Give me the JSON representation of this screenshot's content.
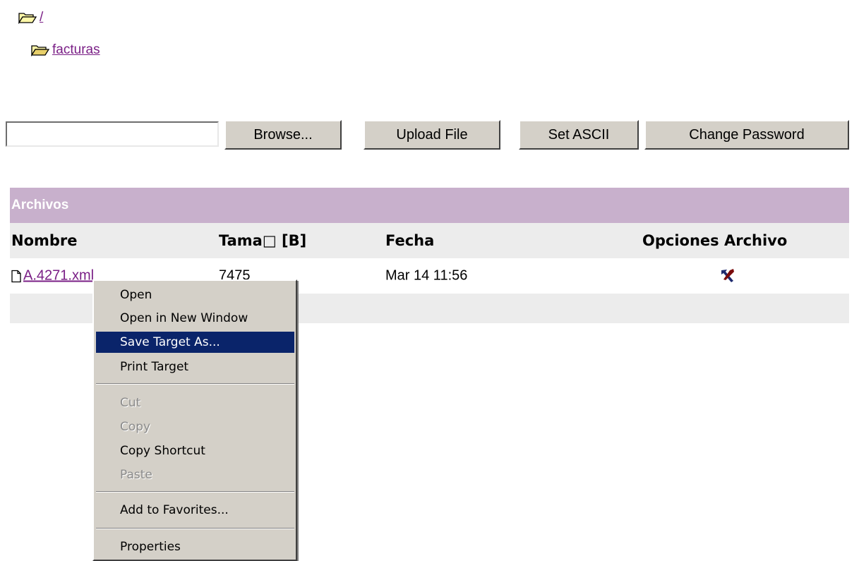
{
  "tree": {
    "root_label": "/",
    "sub_label": "facturas"
  },
  "toolbar": {
    "file_value": "",
    "browse_label": "Browse...",
    "upload_label": "Upload File",
    "ascii_label": "Set ASCII",
    "password_label": "Change Password"
  },
  "table": {
    "section_title": "Archivos",
    "headers": [
      "Nombre",
      "Tama□ [B]",
      "Fecha",
      "Opciones Archivo"
    ],
    "rows": [
      {
        "name": "A.4271.xml",
        "size": "7475",
        "date": "Mar 14 11:56",
        "option_icon": "tools-icon"
      }
    ]
  },
  "context_menu": {
    "items": [
      {
        "label": "Open",
        "state": "normal"
      },
      {
        "label": "Open in New Window",
        "state": "normal"
      },
      {
        "label": "Save Target As...",
        "state": "highlighted"
      },
      {
        "label": "Print Target",
        "state": "normal"
      },
      {
        "label": "Cut",
        "state": "disabled"
      },
      {
        "label": "Copy",
        "state": "disabled"
      },
      {
        "label": "Copy Shortcut",
        "state": "normal"
      },
      {
        "label": "Paste",
        "state": "disabled"
      },
      {
        "label": "Add to Favorites...",
        "state": "normal"
      },
      {
        "label": "Properties",
        "state": "normal"
      }
    ]
  },
  "colors": {
    "section_header_bg": "#c8b0cc",
    "menu_highlight": "#0a246a",
    "link": "#7a1f86"
  }
}
